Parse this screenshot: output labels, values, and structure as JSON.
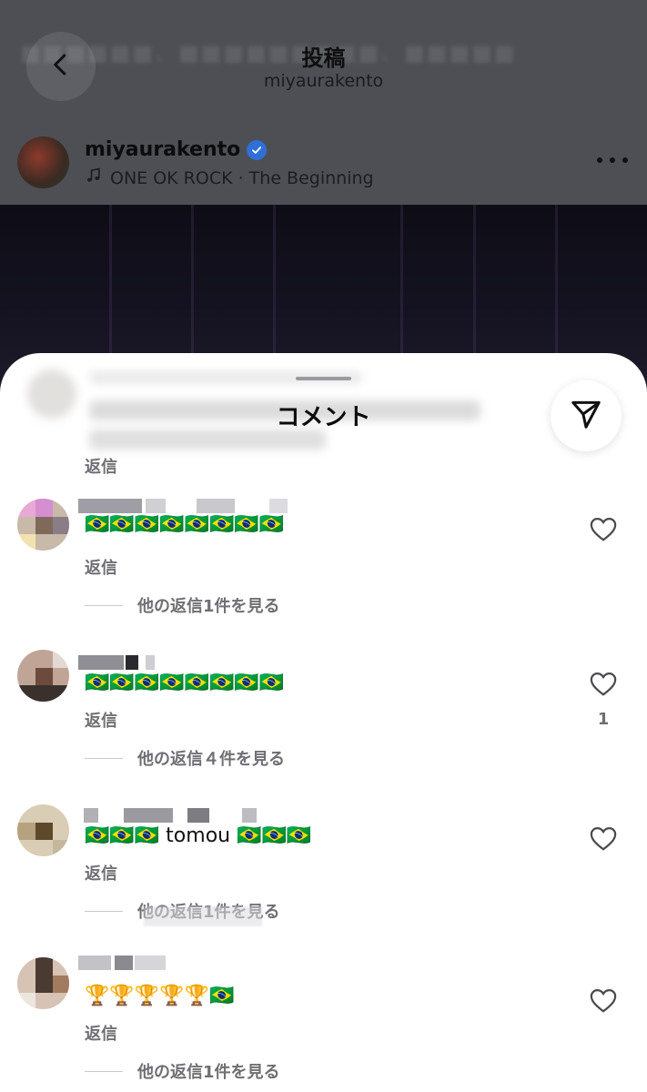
{
  "header": {
    "title": "投稿",
    "subtitle": "miyaurakento"
  },
  "post": {
    "author": "miyaurakento",
    "music": "ONE OK ROCK · The Beginning"
  },
  "sheet": {
    "title": "コメント",
    "top_reply_label": "返信"
  },
  "comments": [
    {
      "text": "🇧🇷🇧🇷🇧🇷🇧🇷🇧🇷🇧🇷🇧🇷🇧🇷",
      "reply_label": "返信",
      "view_replies": "他の返信1件を見る",
      "likes": ""
    },
    {
      "text": "🇧🇷🇧🇷🇧🇷🇧🇷🇧🇷🇧🇷🇧🇷🇧🇷",
      "reply_label": "返信",
      "view_replies": "他の返信４件を見る",
      "likes": "1"
    },
    {
      "text": "🇧🇷🇧🇷🇧🇷 tomou 🇧🇷🇧🇷🇧🇷",
      "reply_label": "返信",
      "view_replies": "他の返信1件を見る",
      "likes": ""
    },
    {
      "text": "🏆🏆🏆🏆🏆🇧🇷",
      "reply_label": "返信",
      "view_replies": "他の返信1件を見る",
      "likes": ""
    }
  ],
  "icons": {
    "back": "chevron-left-icon",
    "verified": "verified-badge-icon",
    "music": "music-note-icon",
    "more": "more-horizontal-icon",
    "share": "send-icon",
    "like": "heart-icon"
  },
  "colors": {
    "verified": "#2f6fd6",
    "secondary_text": "#6f6f74",
    "sheet_bg": "#ffffff",
    "dim_overlay": "#4d4f55"
  }
}
